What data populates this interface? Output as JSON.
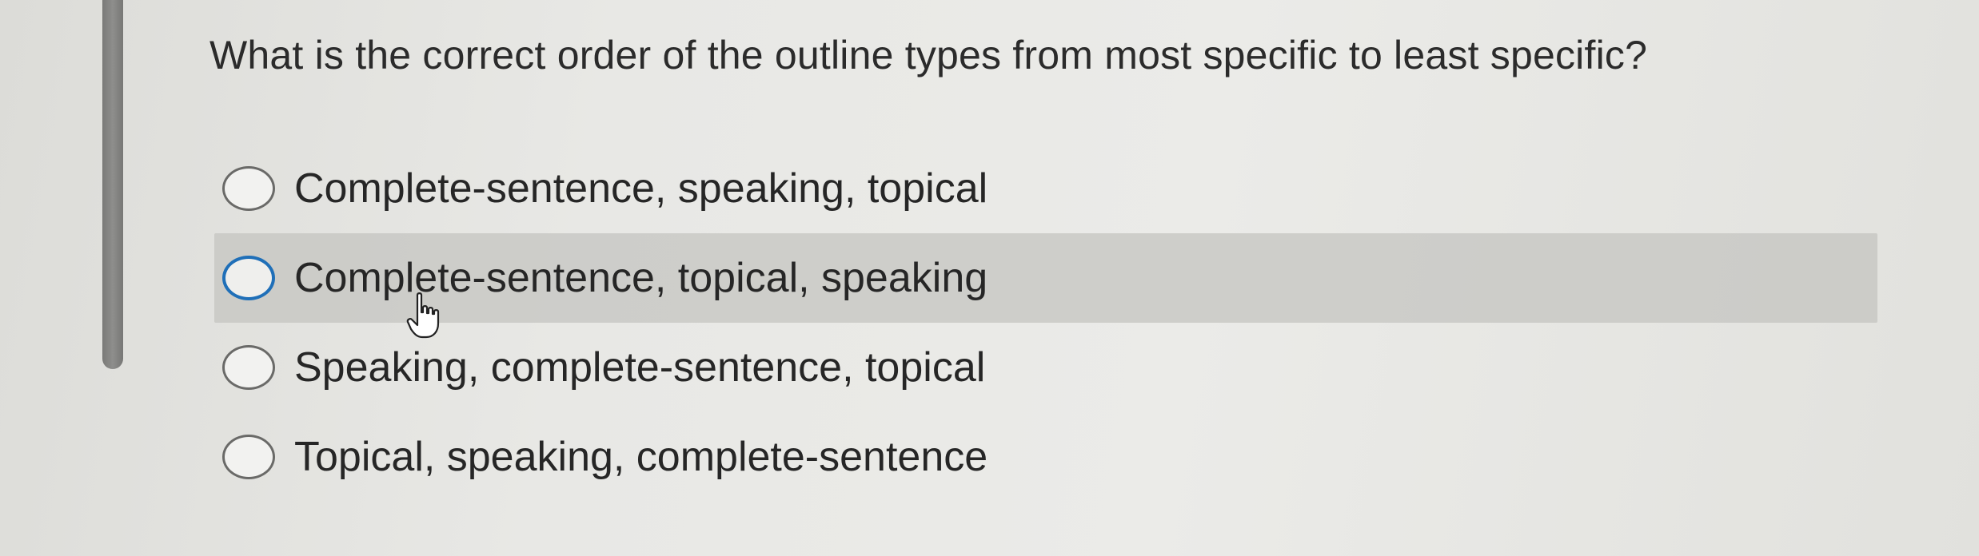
{
  "question": {
    "text": "What is the correct order of the outline types from most specific to least specific?"
  },
  "options": [
    {
      "label": "Complete-sentence, speaking, topical"
    },
    {
      "label": "Complete-sentence, topical, speaking"
    },
    {
      "label": "Speaking, complete-sentence, topical"
    },
    {
      "label": "Topical, speaking, complete-sentence"
    }
  ],
  "colors": {
    "hover_radio_accent": "#1f6fb8",
    "hover_row_background": "#c4c4c0"
  },
  "icons": {
    "cursor": "hand-pointer-icon"
  }
}
